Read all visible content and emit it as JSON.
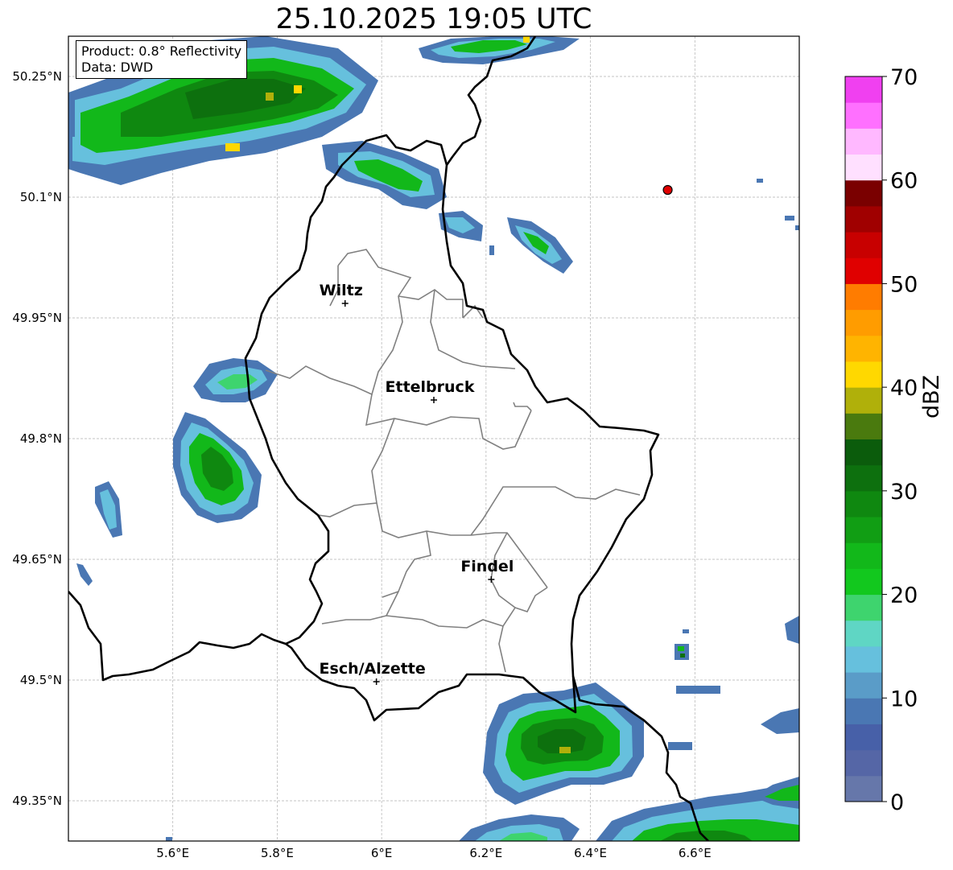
{
  "title": "25.10.2025 19:05 UTC",
  "info_box": {
    "product": "Product: 0.8° Reflectivity",
    "source": "Data: DWD"
  },
  "map": {
    "lon_range": [
      5.4,
      6.8
    ],
    "lat_range": [
      49.3,
      50.3
    ],
    "lon_ticks": [
      {
        "value": 5.6,
        "label": "5.6°E"
      },
      {
        "value": 5.8,
        "label": "5.8°E"
      },
      {
        "value": 6.0,
        "label": "6°E"
      },
      {
        "value": 6.2,
        "label": "6.2°E"
      },
      {
        "value": 6.4,
        "label": "6.4°E"
      },
      {
        "value": 6.6,
        "label": "6.6°E"
      }
    ],
    "lat_ticks": [
      {
        "value": 50.25,
        "label": "50.25°N"
      },
      {
        "value": 50.1,
        "label": "50.1°N"
      },
      {
        "value": 49.95,
        "label": "49.95°N"
      },
      {
        "value": 49.8,
        "label": "49.8°N"
      },
      {
        "value": 49.65,
        "label": "49.65°N"
      },
      {
        "value": 49.5,
        "label": "49.5°N"
      },
      {
        "value": 49.35,
        "label": "49.35°N"
      }
    ],
    "cities": [
      {
        "name": "Wiltz",
        "lon": 5.93,
        "lat": 49.968
      },
      {
        "name": "Ettelbruck",
        "lon": 6.1,
        "lat": 49.848
      },
      {
        "name": "Findel",
        "lon": 6.21,
        "lat": 49.625
      },
      {
        "name": "Esch/Alzette",
        "lon": 5.99,
        "lat": 49.498
      }
    ],
    "radar_site": {
      "lon": 6.548,
      "lat": 50.109,
      "color": "#e00000"
    }
  },
  "colorbar": {
    "label": "dBZ",
    "min": 0,
    "max": 70,
    "ticks": [
      0,
      10,
      20,
      30,
      40,
      50,
      60,
      70
    ],
    "colors": [
      "#6677aa",
      "#5566a6",
      "#4760a8",
      "#4a77b3",
      "#5a9cc8",
      "#66c0dd",
      "#5fd6c4",
      "#3ed46e",
      "#12c81e",
      "#12b81a",
      "#119e14",
      "#0f8810",
      "#0d700e",
      "#0b5c0c",
      "#4a7a0e",
      "#b0b00a",
      "#ffd800",
      "#ffb400",
      "#ff9c00",
      "#ff7c00",
      "#e00000",
      "#c80000",
      "#a00000",
      "#7a0000",
      "#ffe0ff",
      "#ffb8ff",
      "#ff70ff",
      "#f040f0"
    ]
  }
}
